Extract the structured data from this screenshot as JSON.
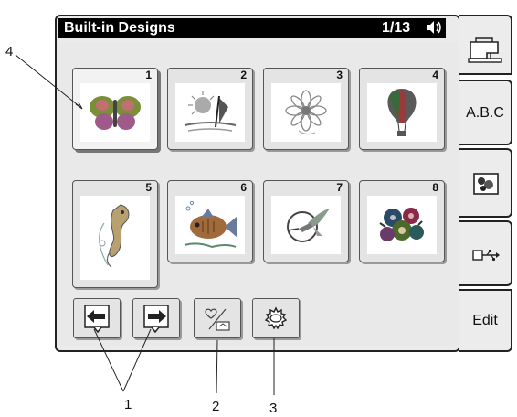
{
  "header": {
    "title": "Built-in Designs",
    "page_indicator": "1/13"
  },
  "designs": [
    {
      "number": "1",
      "name": "butterfly"
    },
    {
      "number": "2",
      "name": "sun-sailboat"
    },
    {
      "number": "3",
      "name": "flower"
    },
    {
      "number": "4",
      "name": "hot-air-balloon"
    },
    {
      "number": "5",
      "name": "seahorse"
    },
    {
      "number": "6",
      "name": "fish"
    },
    {
      "number": "7",
      "name": "hummingbird"
    },
    {
      "number": "8",
      "name": "flower-bouquet"
    }
  ],
  "toolbar": [
    {
      "icon": "arrow-left-icon"
    },
    {
      "icon": "arrow-right-icon"
    },
    {
      "icon": "favorite-icon"
    },
    {
      "icon": "settings-gear-icon"
    }
  ],
  "side_tabs": {
    "abc_label": "A.B.C",
    "edit_label": "Edit"
  },
  "callouts": {
    "c1": "1",
    "c2": "2",
    "c3": "3",
    "c4": "4"
  },
  "colors": {
    "title_bar": "#000000",
    "panel": "#e9e9e9"
  }
}
